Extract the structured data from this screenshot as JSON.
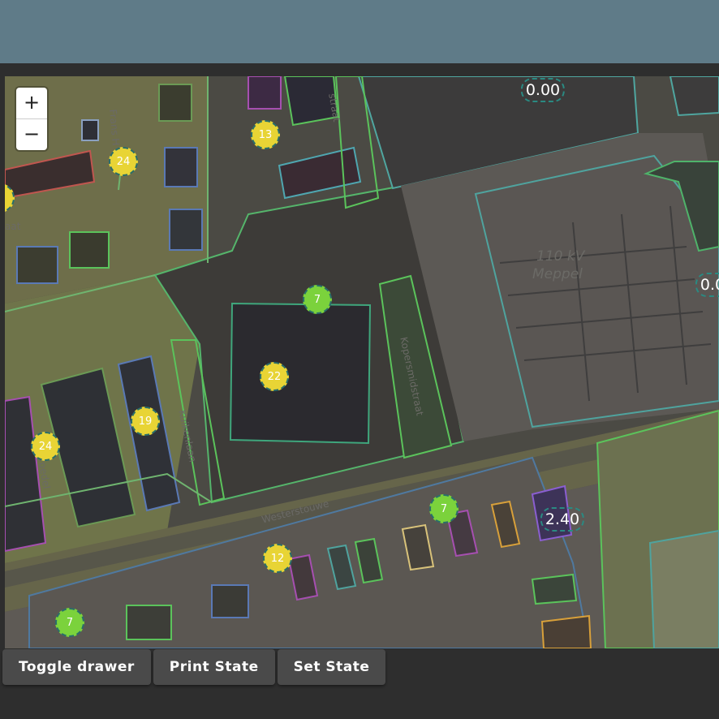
{
  "zoom": {
    "in_label": "+",
    "out_label": "−"
  },
  "markers": [
    {
      "label": "13",
      "color": "yellow"
    },
    {
      "label": "24",
      "color": "yellow"
    },
    {
      "label": "7",
      "color": "green"
    },
    {
      "label": "22",
      "color": "yellow"
    },
    {
      "label": "19",
      "color": "yellow"
    },
    {
      "label": "24",
      "color": "yellow"
    },
    {
      "label": "7",
      "color": "green"
    },
    {
      "label": "12",
      "color": "yellow"
    },
    {
      "label": "7",
      "color": "green"
    }
  ],
  "value_labels": [
    "0.00",
    "0.0",
    "2.40"
  ],
  "street_labels": {
    "frans": "Frans H",
    "kuikenlaan": "Kuikenlaan",
    "westerstouwe": "Westerstouwe",
    "kopersmid": "Kopersmidstraat",
    "roedel": "roedel",
    "aat": "aat",
    "straat": "straat"
  },
  "substation_label": {
    "line1": "110 kV",
    "line2": "Meppel"
  },
  "buttons": {
    "toggle_drawer": "Toggle drawer",
    "print_state": "Print State",
    "set_state": "Set State"
  },
  "colors": {
    "header": "#5f7b88",
    "background": "#2e2e2e",
    "marker_yellow": "#e8d435",
    "marker_green": "#7bd23c"
  }
}
